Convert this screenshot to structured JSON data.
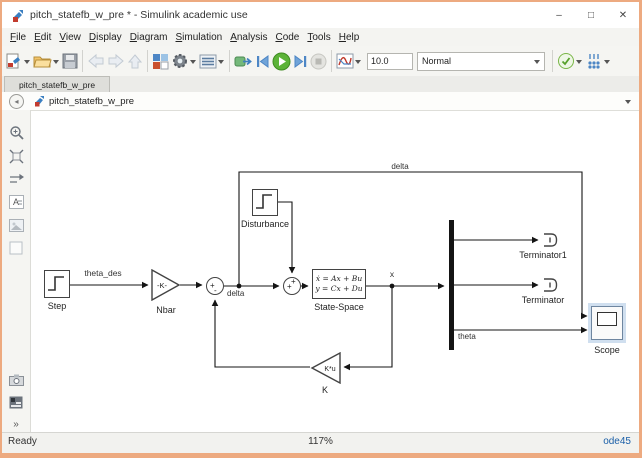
{
  "window": {
    "title": "pitch_statefb_w_pre * - Simulink academic use",
    "minimize": "–",
    "maximize": "□",
    "close": "✕"
  },
  "menu": {
    "items": [
      "File",
      "Edit",
      "View",
      "Display",
      "Diagram",
      "Simulation",
      "Analysis",
      "Code",
      "Tools",
      "Help"
    ]
  },
  "toolbar": {
    "stop_time": "10.0",
    "sim_mode": "Normal"
  },
  "tabs": {
    "active": "pitch_statefb_w_pre"
  },
  "breadcrumb": {
    "model": "pitch_statefb_w_pre"
  },
  "sidebar": {
    "collapse_label": "»"
  },
  "statusbar": {
    "status": "Ready",
    "zoom": "117%",
    "solver": "ode45"
  },
  "colors": {
    "window_border": "#edaa80",
    "play_green": "#5cb338",
    "solver_blue": "#1a5fa8",
    "scope_halo": "#a9c7e4"
  },
  "icons": {
    "app": "simulink-model-icon",
    "toolbar": [
      "new-model-icon",
      "open-icon",
      "save-icon",
      "back-icon",
      "forward-icon",
      "up-icon",
      "library-browser-icon",
      "gear-icon",
      "model-config-icon",
      "sim-io-icon",
      "step-back-icon",
      "run-icon",
      "step-forward-icon",
      "stop-icon",
      "data-inspector-icon",
      "check-icon",
      "build-icon"
    ],
    "palette": [
      "zoom-icon",
      "fit-view-icon",
      "signal-routing-icon",
      "annotation-icon",
      "image-icon",
      "area-icon",
      "camera-icon",
      "model-browser-icon"
    ]
  },
  "diagram": {
    "step": {
      "label": "Step"
    },
    "nbar": {
      "text": "-K-",
      "label": "Nbar"
    },
    "sum1": {
      "sign_left": "+",
      "sign_bottom": "-"
    },
    "sum2": {
      "sign_left": "+",
      "sign_top": "+"
    },
    "disturbance": {
      "label": "Disturbance"
    },
    "state_space": {
      "eq1": "ẋ = Ax + Bu",
      "eq2": "y = Cx + Du",
      "label": "State-Space"
    },
    "k_gain": {
      "text": "K*u",
      "label": "K"
    },
    "terminator1": {
      "label": "Terminator1"
    },
    "terminator": {
      "label": "Terminator"
    },
    "scope": {
      "label": "Scope"
    },
    "signals": {
      "theta_des": "theta_des",
      "delta": "delta",
      "x": "x",
      "theta": "theta"
    }
  }
}
